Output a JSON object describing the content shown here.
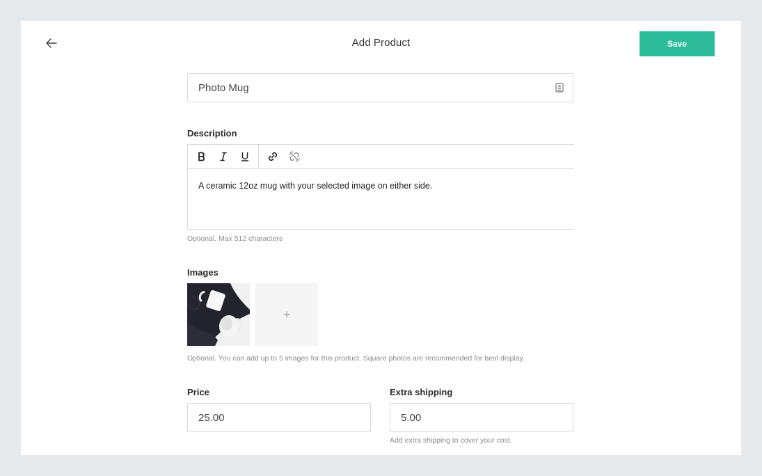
{
  "header": {
    "title": "Add Product",
    "save_label": "Save",
    "accent_color": "#2ebd9b"
  },
  "product_name": {
    "value": "Photo Mug",
    "icon": "autofill-icon"
  },
  "description": {
    "label": "Description",
    "toolbar": [
      "bold-icon",
      "italic-icon",
      "underline-icon",
      "link-icon",
      "unlink-icon"
    ],
    "text": "A ceramic 12oz mug with your selected image on either side.",
    "hint": "Optional. Max 512 characters"
  },
  "images": {
    "label": "Images",
    "add_symbol": "+",
    "hint": "Optional. You can add up to 5 images for this product. Square photos are recommended for best display."
  },
  "price": {
    "label": "Price",
    "value": "25.00"
  },
  "shipping": {
    "label": "Extra shipping",
    "value": "5.00",
    "hint": "Add extra shipping to cover your cost."
  }
}
